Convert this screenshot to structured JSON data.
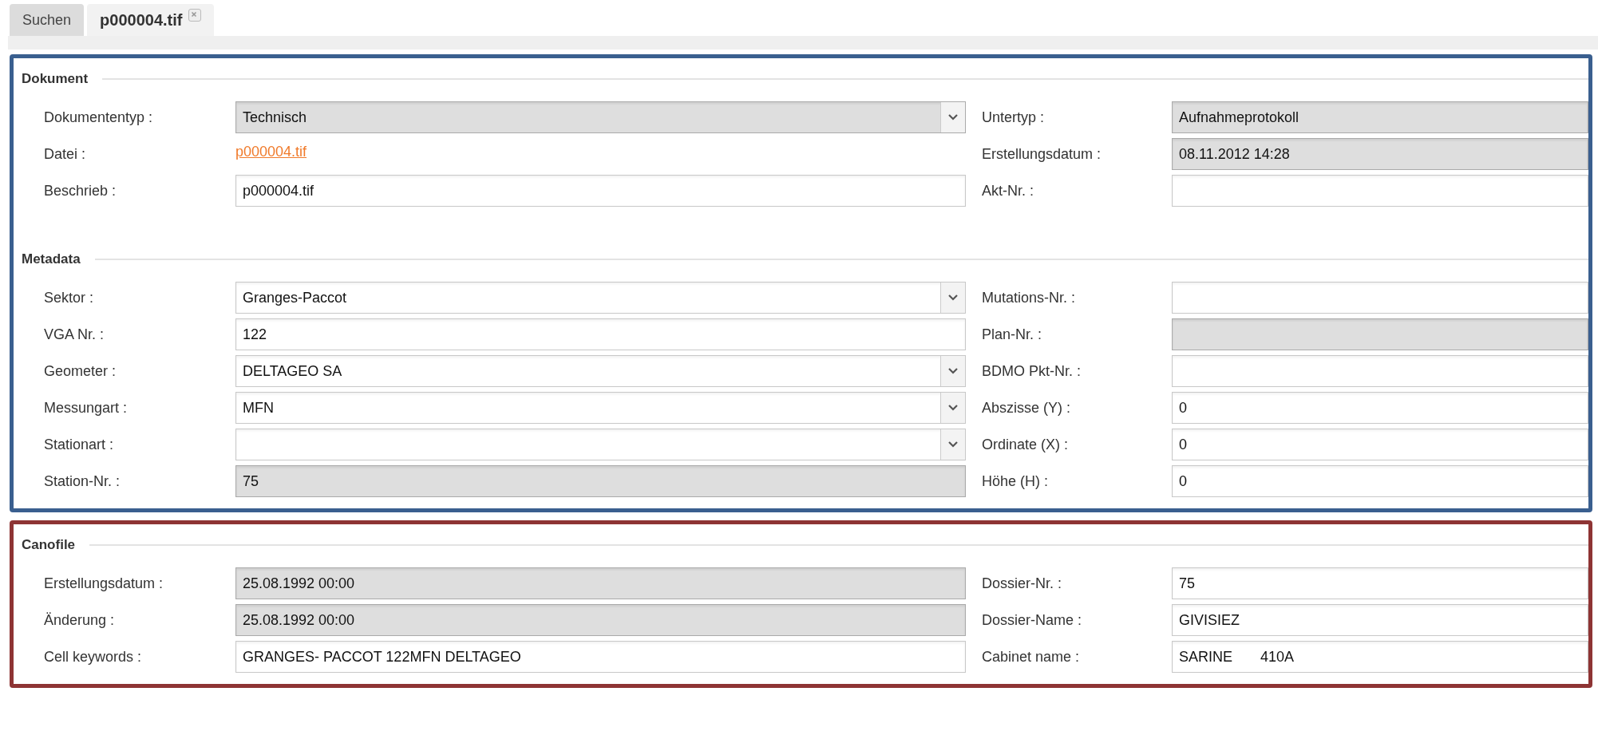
{
  "tabs": [
    {
      "label": "Suchen",
      "selected": false,
      "closable": false
    },
    {
      "label": "p000004.tif",
      "selected": true,
      "closable": true
    }
  ],
  "panels": [
    {
      "color": "#3a5f8f",
      "sections": [
        {
          "title": "Dokument",
          "rows": [
            {
              "left": {
                "label": "Dokumententyp :",
                "kind": "select",
                "disabled": true,
                "value": "Technisch"
              },
              "right": {
                "label": "Untertyp :",
                "kind": "text",
                "disabled": true,
                "value": "Aufnahmeprotokoll"
              }
            },
            {
              "left": {
                "label": "Datei :",
                "kind": "link",
                "value": "p000004.tif"
              },
              "right": {
                "label": "Erstellungsdatum :",
                "kind": "text",
                "disabled": true,
                "value": "08.11.2012 14:28"
              }
            },
            {
              "left": {
                "label": "Beschrieb :",
                "kind": "text",
                "disabled": false,
                "value": "p000004.tif"
              },
              "right": {
                "label": "Akt-Nr. :",
                "kind": "text",
                "disabled": false
              }
            }
          ]
        },
        {
          "title": "Metadata",
          "rows": [
            {
              "left": {
                "label": "Sektor :",
                "kind": "select",
                "disabled": false,
                "value": "Granges-Paccot"
              },
              "right": {
                "label": "Mutations-Nr. :",
                "kind": "text",
                "disabled": false
              }
            },
            {
              "left": {
                "label": "VGA Nr. :",
                "kind": "text",
                "disabled": false,
                "value": "122"
              },
              "right": {
                "label": "Plan-Nr. :",
                "kind": "text",
                "disabled": true
              }
            },
            {
              "left": {
                "label": "Geometer :",
                "kind": "select",
                "disabled": false,
                "value": "DELTAGEO SA"
              },
              "right": {
                "label": "BDMO Pkt-Nr. :",
                "kind": "text",
                "disabled": false
              }
            },
            {
              "left": {
                "label": "Messungart :",
                "kind": "select",
                "disabled": false,
                "value": "MFN"
              },
              "right": {
                "label": "Abszisse (Y) :",
                "kind": "text",
                "disabled": false,
                "value": "0"
              }
            },
            {
              "left": {
                "label": "Stationart :",
                "kind": "select",
                "disabled": false
              },
              "right": {
                "label": "Ordinate (X) :",
                "kind": "text",
                "disabled": false,
                "value": "0"
              }
            },
            {
              "left": {
                "label": "Station-Nr. :",
                "kind": "text",
                "disabled": true,
                "value": "75"
              },
              "right": {
                "label": "Höhe (H) :",
                "kind": "text",
                "disabled": false,
                "value": "0"
              }
            }
          ]
        }
      ]
    },
    {
      "color": "#8e3434",
      "sections": [
        {
          "title": "Canofile",
          "rows": [
            {
              "left": {
                "label": "Erstellungsdatum :",
                "kind": "text",
                "disabled": true,
                "value": "25.08.1992 00:00"
              },
              "right": {
                "label": "Dossier-Nr. :",
                "kind": "text",
                "disabled": false,
                "value": "75"
              }
            },
            {
              "left": {
                "label": "Änderung :",
                "kind": "text",
                "disabled": true,
                "value": "25.08.1992 00:00"
              },
              "right": {
                "label": "Dossier-Name :",
                "kind": "text",
                "disabled": false,
                "value": "GIVISIEZ"
              }
            },
            {
              "left": {
                "label": "Cell keywords :",
                "kind": "text",
                "disabled": false,
                "value": "GRANGES- PACCOT 122MFN DELTAGEO"
              },
              "right": {
                "label": "Cabinet name :",
                "kind": "text",
                "disabled": false,
                "value": "SARINE       410A"
              }
            }
          ]
        }
      ]
    }
  ]
}
